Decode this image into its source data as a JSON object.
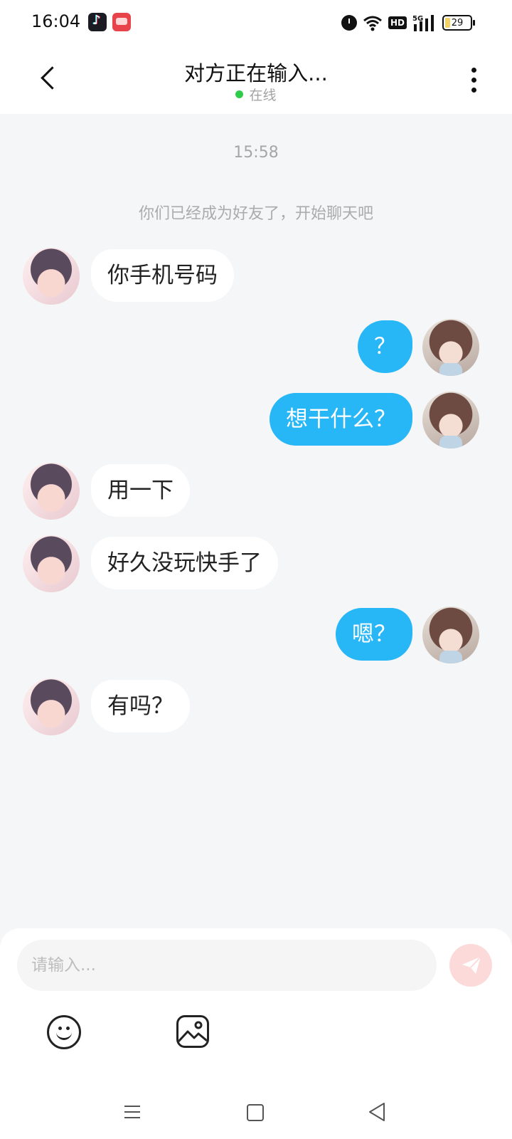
{
  "status_bar": {
    "time": "16:04",
    "apps": [
      "tiktok-icon",
      "shopping-app-icon"
    ],
    "icons": [
      "alarm-icon",
      "wifi-icon",
      "hd-icon",
      "signal-5g-icon",
      "battery-icon"
    ],
    "hd_label": "HD",
    "network_label": "5G",
    "battery": "29",
    "battery_fraction": 0.29
  },
  "header": {
    "title": "对方正在输入...",
    "status": "在线",
    "status_color": "#2fcc4a",
    "back_icon": "chevron-left-icon",
    "more_icon": "more-vertical-icon"
  },
  "chat": {
    "timestamp": "15:58",
    "system_message": "你们已经成为好友了，开始聊天吧",
    "messages": [
      {
        "side": "left",
        "text": "你手机号码"
      },
      {
        "side": "right",
        "text": "？"
      },
      {
        "side": "right",
        "text": "想干什么？"
      },
      {
        "side": "left",
        "text": "用一下"
      },
      {
        "side": "left",
        "text": "好久没玩快手了"
      },
      {
        "side": "right",
        "text": "嗯？"
      },
      {
        "side": "left",
        "text": "有吗？"
      }
    ]
  },
  "composer": {
    "placeholder": "请输入...",
    "value": "",
    "send_icon": "send-icon",
    "emoji_icon": "smiley-icon",
    "image_icon": "image-icon"
  },
  "colors": {
    "accent": "#27b7f7",
    "background": "#f5f6f8",
    "send_button_disabled": "#fcdada"
  },
  "navigation_bar": [
    "menu-icon",
    "home-icon",
    "back-icon"
  ]
}
